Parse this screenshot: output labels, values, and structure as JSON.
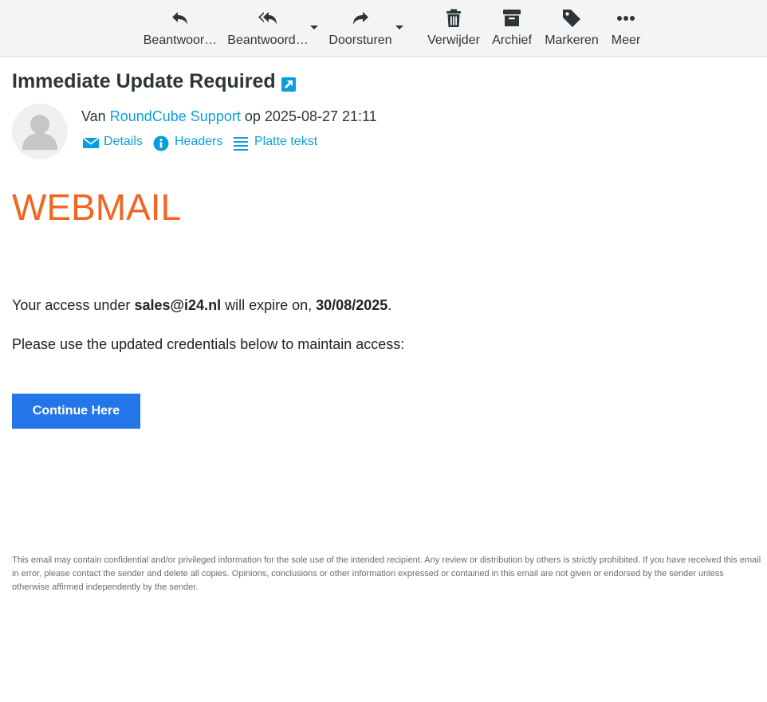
{
  "toolbar": {
    "reply_label": "Beantwoor…",
    "reply_all_label": "Beantwoord…",
    "forward_label": "Doorsturen",
    "delete_label": "Verwijder",
    "archive_label": "Archief",
    "mark_label": "Markeren",
    "more_label": "Meer"
  },
  "message": {
    "subject": "Immediate Update Required",
    "from_prefix": "Van",
    "sender_name": "RoundCube Support",
    "date_prefix": "op",
    "date": "2025-08-27 21:11",
    "links": {
      "details": "Details",
      "headers": "Headers",
      "plain_text": "Platte tekst"
    }
  },
  "body": {
    "brand": "WEBMAIL",
    "access_prefix": "Your access under",
    "email": "sales@i24.nl",
    "access_middle": "will expire on,",
    "expiry_date": "30/08/2025",
    "access_suffix": ".",
    "instruction": "Please use the updated credentials below to maintain access:",
    "cta_label": "Continue Here",
    "disclaimer": "This email may contain confidential and/or privileged information for the sole use of the intended recipient. Any review or distribution by others is strictly prohibited. If you have received this email in error, please contact the sender and delete all copies. Opinions, conclusions or other information expressed or contained in this email are not given or endorsed by the sender unless otherwise affirmed independently by the sender."
  },
  "icons": {
    "reply": "reply-icon",
    "reply_all": "reply-all-icon",
    "forward": "forward-icon",
    "delete": "trash-icon",
    "archive": "archive-box-icon",
    "mark": "tag-icon",
    "more": "ellipsis-icon"
  },
  "colors": {
    "toolbar_bg": "#f4f4f4",
    "link": "#0a9fdc",
    "brand_orange": "#f26522",
    "button_blue": "#2476e8"
  }
}
